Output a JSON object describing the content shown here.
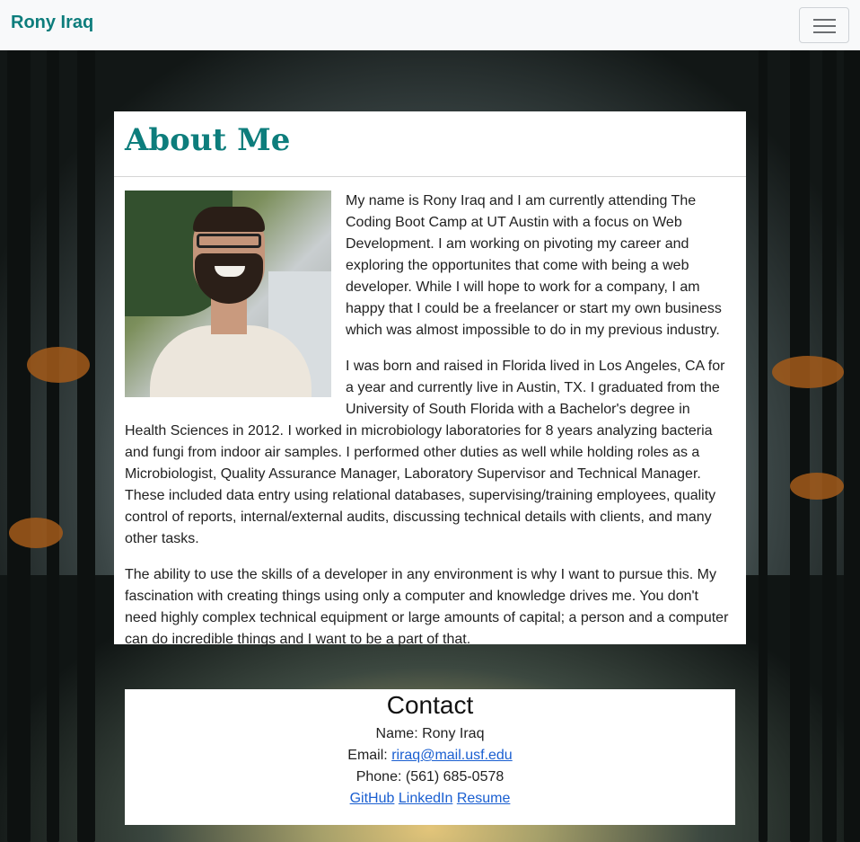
{
  "navbar": {
    "brand": "Rony Iraq",
    "toggle_icon": "hamburger-icon"
  },
  "about": {
    "title": "About Me",
    "portrait_alt": "portrait photo",
    "paragraphs": [
      "My name is Rony Iraq and I am currently attending The Coding Boot Camp at UT Austin with a focus on Web Development. I am working on pivoting my career and exploring the opportunites that come with being a web developer. While I will hope to work for a company, I am happy that I could be a freelancer or start my own business which was almost impossible to do in my previous industry.",
      "I was born and raised in Florida lived in Los Angeles, CA for a year and currently live in Austin, TX. I graduated from the University of South Florida with a Bachelor's degree in Health Sciences in 2012. I worked in microbiology laboratories for 8 years analyzing bacteria and fungi from indoor air samples. I performed other duties as well while holding roles as a Microbiologist, Quality Assurance Manager, Laboratory Supervisor and Technical Manager. These included data entry using relational databases, supervising/training employees, quality control of reports, internal/external audits, discussing technical details with clients, and many other tasks.",
      "The ability to use the skills of a developer in any environment is why I want to pursue this. My fascination with creating things using only a computer and knowledge drives me. You don't need highly complex technical equipment or large amounts of capital; a person and a computer can do incredible things and I want to be a part of that."
    ]
  },
  "contact": {
    "title": "Contact",
    "name_label": "Name: ",
    "name": "Rony Iraq",
    "email_label": "Email: ",
    "email": "riraq@mail.usf.edu",
    "phone_label": "Phone: ",
    "phone": "(561) 685-0578",
    "links": {
      "github": "GitHub",
      "linkedin": "LinkedIn",
      "resume": "Resume"
    }
  },
  "colors": {
    "brand": "#0d7d7c",
    "link": "#1a5fd1",
    "navbar_bg": "#f8f9fa"
  }
}
